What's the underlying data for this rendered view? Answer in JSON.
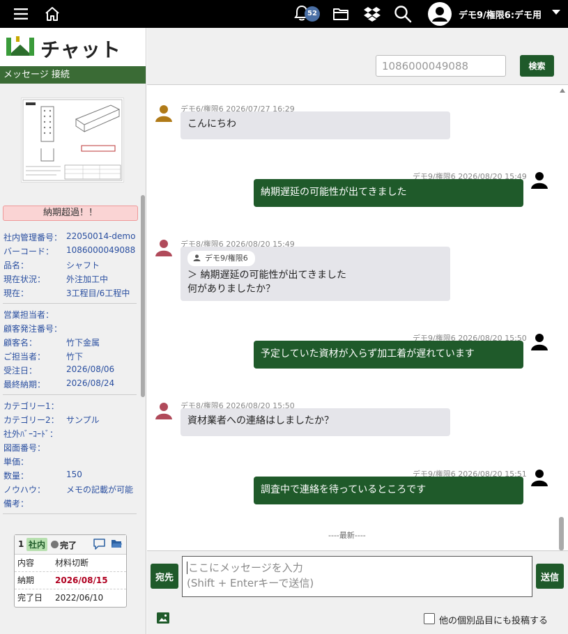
{
  "header": {
    "notification_count": "52",
    "user_label": "デモ9/権限6:デモ用"
  },
  "sidebar": {
    "logo_text": "チャット",
    "section_label": "メッセージ 接続",
    "alert": "納期超過！！",
    "details": [
      {
        "label": "社内管理番号：",
        "value": "22050014-demo"
      },
      {
        "label": "バーコード：",
        "value": "1086000049088"
      },
      {
        "label": "品名：",
        "value": "シャフト"
      },
      {
        "label": "現在状況：",
        "value": "外注加工中"
      },
      {
        "label": "現在：",
        "value": "3工程目/6工程中"
      },
      {
        "label": "営業担当者：",
        "value": ""
      },
      {
        "label": "顧客発注番号：",
        "value": ""
      },
      {
        "label": "顧客名：",
        "value": "竹下金属"
      },
      {
        "label": "ご担当者：",
        "value": "竹下"
      },
      {
        "label": "受注日：",
        "value": "2026/08/06"
      },
      {
        "label": "最終納期：",
        "value": "2026/08/24"
      },
      {
        "label": "カテゴリー1：",
        "value": ""
      },
      {
        "label": "カテゴリー2：",
        "value": "サンプル"
      },
      {
        "label": "社外ﾊﾞｰｺｰﾄﾞ：",
        "value": ""
      },
      {
        "label": "図面番号：",
        "value": ""
      },
      {
        "label": "単価：",
        "value": ""
      },
      {
        "label": "数量：",
        "value": "150"
      },
      {
        "label": "ノウハウ：",
        "value": "メモの記載が可能"
      },
      {
        "label": "備考：",
        "value": ""
      }
    ],
    "card": {
      "number": "1",
      "tag": "社内",
      "status": "完了",
      "rows": [
        {
          "label": "内容",
          "value": "材料切断"
        },
        {
          "label": "納期",
          "value": "2026/08/15"
        },
        {
          "label": "完了日",
          "value": "2022/06/10"
        }
      ]
    }
  },
  "search": {
    "value": "1086000049088",
    "button_label": "検索"
  },
  "messages": [
    {
      "meta": "デモ6/権限6  2026/07/27 16:29",
      "text": "こんにちわ"
    },
    {
      "meta": "デモ9/権限6  2026/08/20 15:49",
      "text": "納期遅延の可能性が出てきました"
    },
    {
      "meta": "デモ8/権限6  2026/08/20 15:49",
      "quote_user": "デモ9/権限6",
      "text_line1": "＞ 納期遅延の可能性が出てきました",
      "text_line2": "何がありましたか？"
    },
    {
      "meta": "デモ9/権限6  2026/08/20 15:50",
      "text": "予定していた資材が入らず加工着が遅れています"
    },
    {
      "meta": "デモ8/権限6  2026/08/20 15:50",
      "text": "資材業者への連絡はしましたか？"
    },
    {
      "meta": "デモ9/権限6  2026/08/20 15:51",
      "text": "調査中で連絡を待っているところです"
    }
  ],
  "latest_marker": "----最新----",
  "composer": {
    "address_button": "宛先",
    "placeholder_line1": "ここにメッセージを入力",
    "placeholder_line2": "(Shift + Enterキーで送信)",
    "send_button": "送信",
    "crosspost_label": "他の個別品目にも投稿する"
  },
  "colors": {
    "brand_green": "#1f5a2a",
    "sidebar_bar": "#3a6b35",
    "alert_bg": "#fad4d4",
    "in_bubble": "#e5e5ea",
    "due_red": "#b00020"
  }
}
